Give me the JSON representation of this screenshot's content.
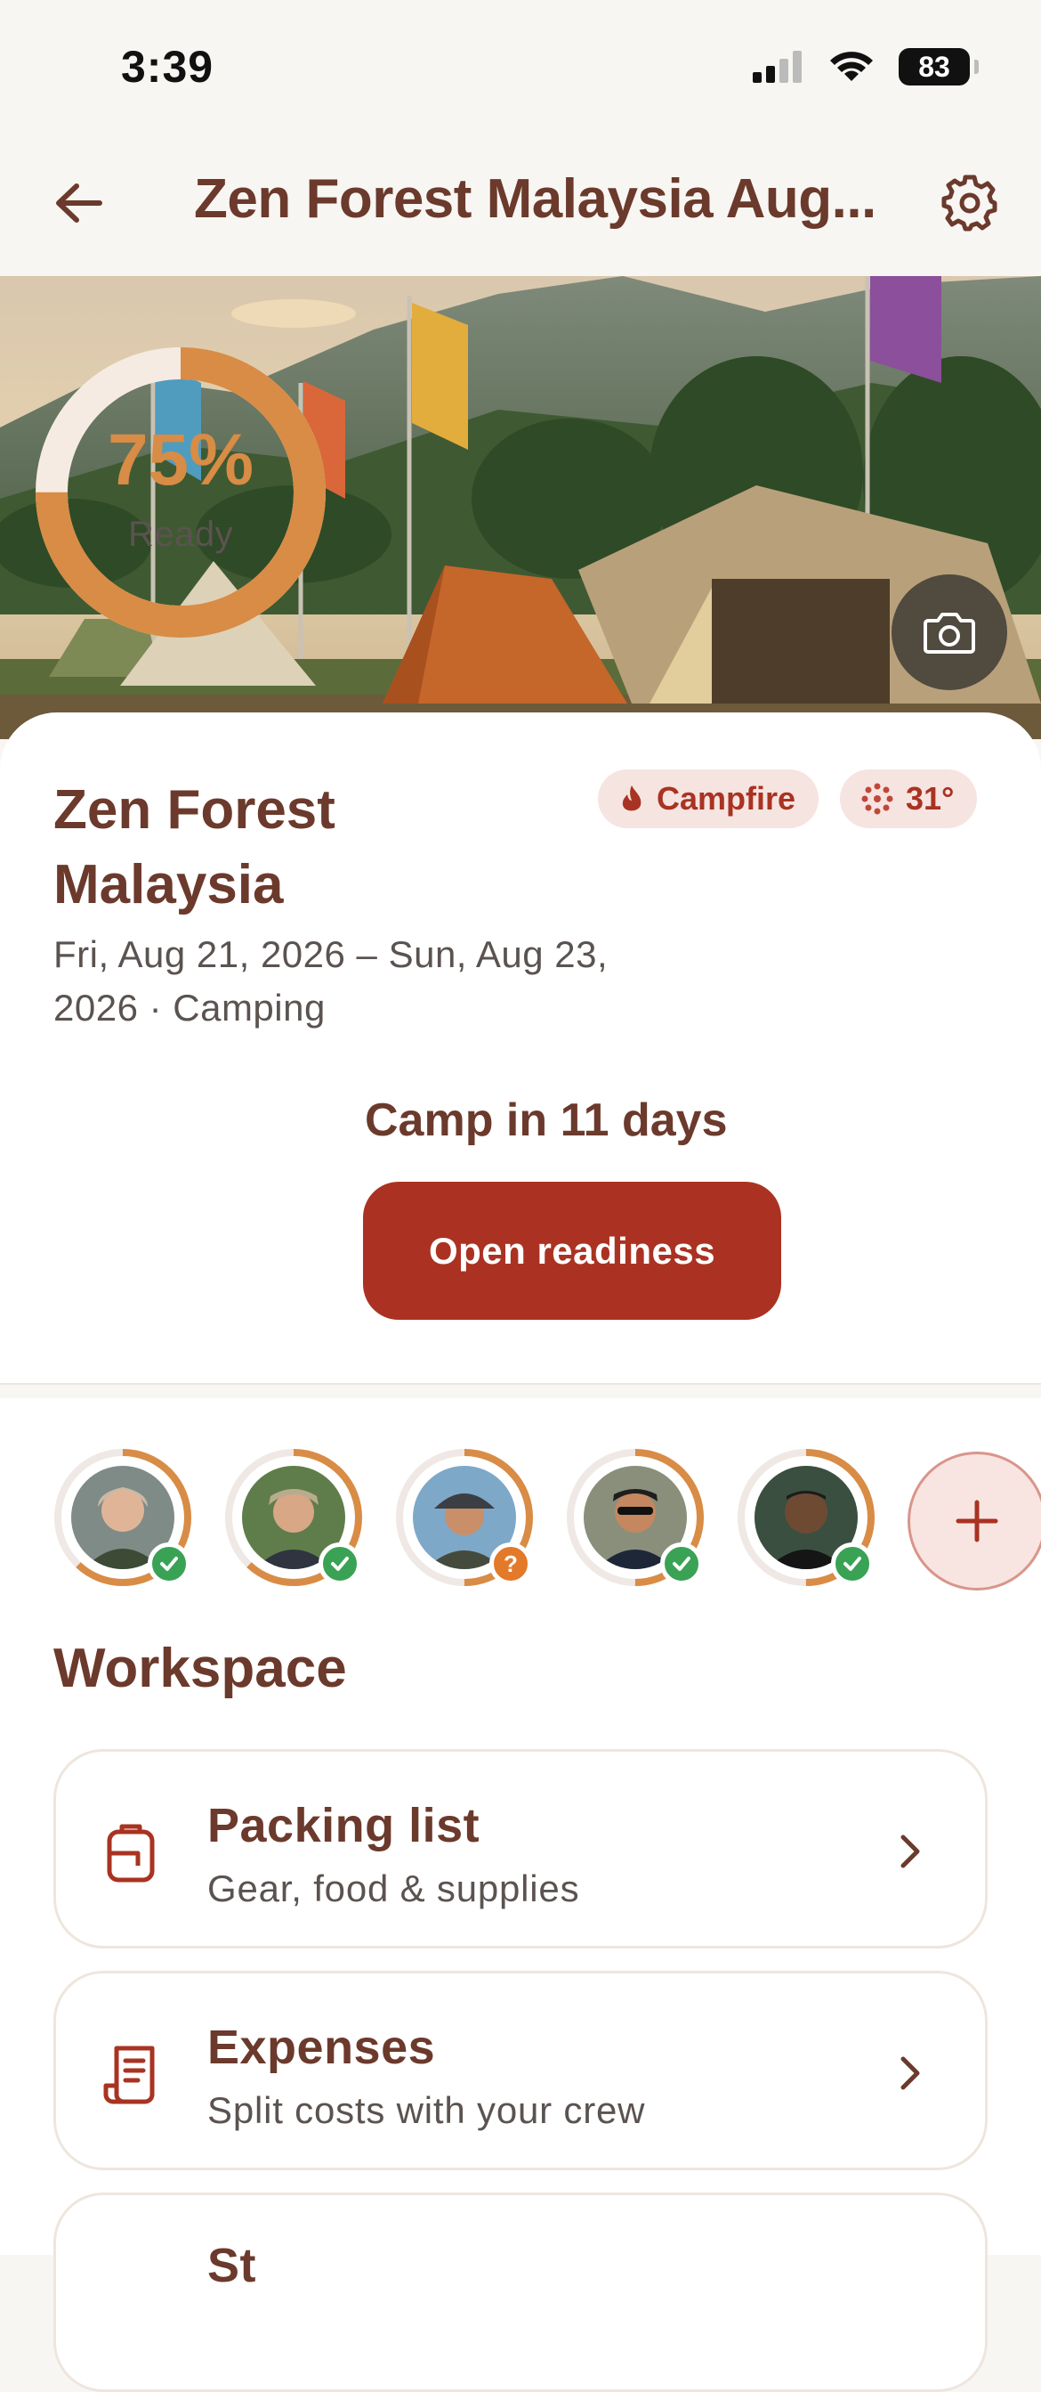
{
  "status_bar": {
    "time": "3:39",
    "battery": "83"
  },
  "header": {
    "title": "Zen Forest Malaysia Aug..."
  },
  "trip": {
    "name": "Zen Forest Malaysia",
    "dates": "Fri, Aug 21, 2026 – Sun, Aug 23, 2026 · Camping",
    "chips": {
      "vibe": "Campfire",
      "temperature": "31°"
    },
    "readiness": {
      "percent_label": "75%",
      "label": "Ready",
      "value": 0.75
    },
    "countdown": "Camp in 11 days",
    "primary_button": "Open readiness"
  },
  "crew": {
    "members": [
      {
        "status": "confirmed",
        "progress": 0.62
      },
      {
        "status": "confirmed",
        "progress": 0.62
      },
      {
        "status": "unknown",
        "progress": 0.5
      },
      {
        "status": "confirmed",
        "progress": 0.5
      },
      {
        "status": "confirmed",
        "progress": 0.5
      }
    ]
  },
  "workspace": {
    "title": "Workspace",
    "items": [
      {
        "title": "Packing list",
        "subtitle": "Gear, food & supplies",
        "icon": "backpack-icon"
      },
      {
        "title": "Expenses",
        "subtitle": "Split costs with your crew",
        "icon": "receipt-icon"
      },
      {
        "title": "St",
        "subtitle": "",
        "icon": ""
      }
    ]
  },
  "colors": {
    "accent": "#ab3222",
    "readiness": "#d88c45",
    "brown_text": "#6b3a2c",
    "success": "#3aa255"
  }
}
